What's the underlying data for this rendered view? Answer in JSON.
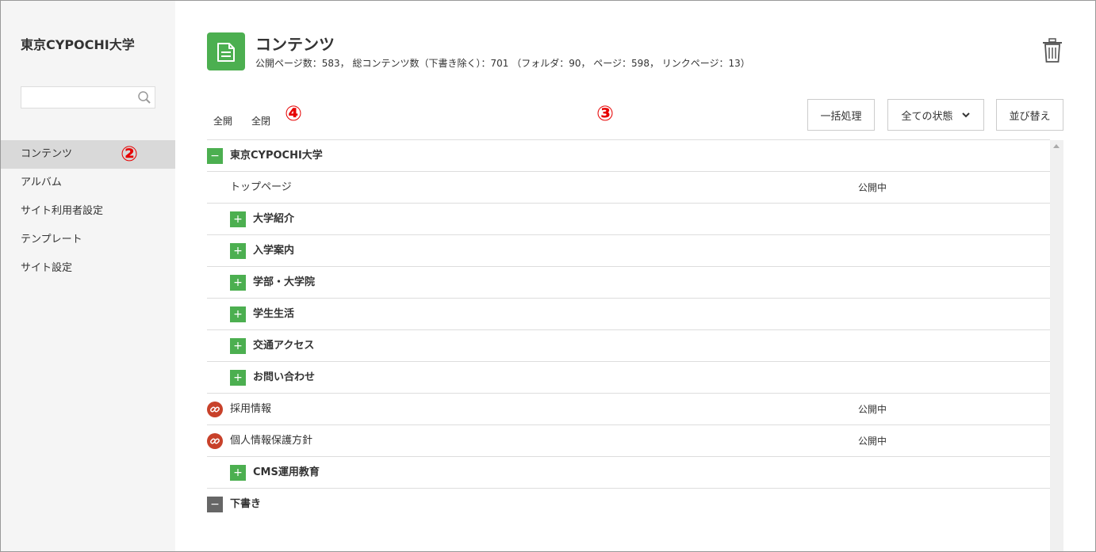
{
  "sidebar": {
    "site_name": "東京CYPOCHI大学",
    "search_placeholder": "",
    "items": [
      {
        "label": "コンテンツ",
        "active": true
      },
      {
        "label": "アルバム",
        "active": false
      },
      {
        "label": "サイト利用者設定",
        "active": false
      },
      {
        "label": "テンプレート",
        "active": false
      },
      {
        "label": "サイト設定",
        "active": false
      }
    ]
  },
  "header": {
    "icon": "document-icon",
    "title": "コンテンツ",
    "stats": "公開ページ数：583， 総コンテンツ数（下書き除く）：701 （フォルダ：90， ページ：598， リンクページ：13）"
  },
  "toolbar": {
    "expand_all": "全開",
    "collapse_all": "全閉",
    "bulk_action": "一括処理",
    "status_filter": "全ての状態",
    "sort": "並び替え"
  },
  "annotations": {
    "mark2": "②",
    "mark3": "③",
    "mark4": "④"
  },
  "tree": {
    "root_label": "東京CYPOCHI大学",
    "rows": [
      {
        "label": "トップページ",
        "status": "公開中"
      },
      {
        "label": "大学紹介"
      },
      {
        "label": "入学案内"
      },
      {
        "label": "学部・大学院"
      },
      {
        "label": "学生生活"
      },
      {
        "label": "交通アクセス"
      },
      {
        "label": "お問い合わせ"
      },
      {
        "label": "採用情報",
        "status": "公開中"
      },
      {
        "label": "個人情報保護方針",
        "status": "公開中"
      },
      {
        "label": "CMS運用教育"
      }
    ],
    "draft_label": "下書き",
    "expand_symbol": "+",
    "collapse_symbol": "−"
  },
  "colors": {
    "accent_green": "#4caf50",
    "link_red": "#c8412a",
    "annotation_red": "#e60000"
  }
}
